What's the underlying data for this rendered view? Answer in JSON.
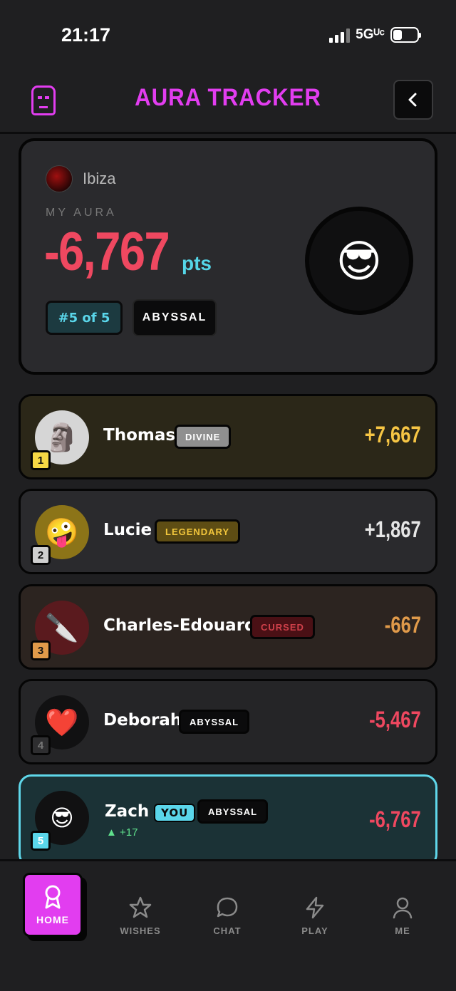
{
  "status_bar": {
    "time": "21:17",
    "network": "5Gᵁᶜ"
  },
  "header": {
    "title": "AURA TRACKER",
    "back_icon": "chevron-left-icon",
    "logo_icon": "moai-icon"
  },
  "my_aura": {
    "group_name": "Ibiza",
    "label": "MY AURA",
    "points": "-6,767",
    "unit": "pts",
    "rank": "#5 of 5",
    "tier": "ABYSSAL",
    "emoji": "😎"
  },
  "leaderboard": [
    {
      "rank": "1",
      "name": "Thomas",
      "tier": "DIVINE",
      "score": "+7,667",
      "emoji": "🗿"
    },
    {
      "rank": "2",
      "name": "Lucie",
      "tier": "LEGENDARY",
      "score": "+1,867",
      "emoji": "🤪"
    },
    {
      "rank": "3",
      "name": "Charles-Edouard",
      "tier": "CURSED",
      "score": "-667",
      "emoji": "🔪"
    },
    {
      "rank": "4",
      "name": "Deborah",
      "tier": "ABYSSAL",
      "score": "-5,467",
      "emoji": "❤️"
    },
    {
      "rank": "5",
      "name": "Zach",
      "you": "YOU",
      "tier": "ABYSSAL",
      "score": "-6,767",
      "emoji": "😎",
      "delta": "▲ +17"
    }
  ],
  "nav": {
    "home": "HOME",
    "wishes": "WISHES",
    "chat": "CHAT",
    "play": "PLAY",
    "me": "ME"
  },
  "colors": {
    "accent": "#e23df0",
    "cyan": "#5ad6ea",
    "negative": "#ef4860",
    "gold": "#f6c544",
    "bronze": "#e09a4a"
  }
}
